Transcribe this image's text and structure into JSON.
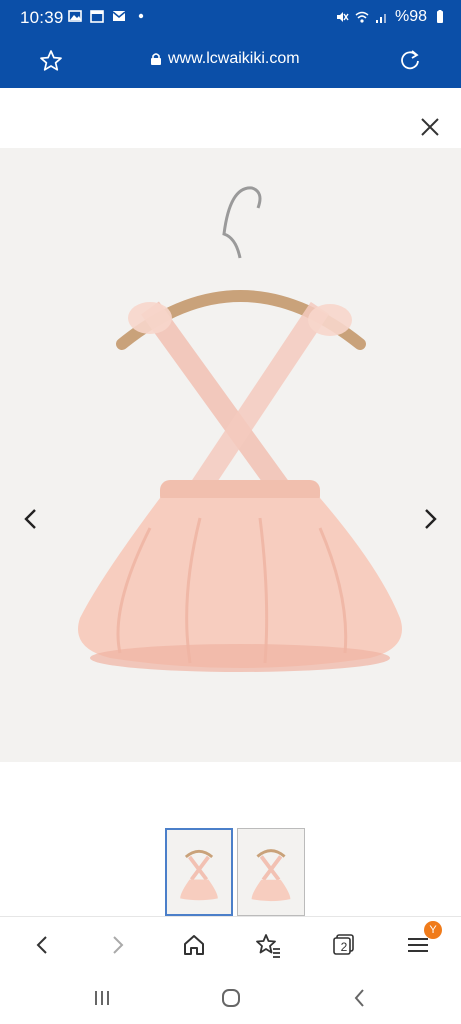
{
  "status_bar": {
    "time": "10:39",
    "battery": "%98",
    "left_icons": [
      "image-icon",
      "calendar-icon",
      "mail-icon",
      "dot-icon"
    ],
    "right_icons": [
      "mute-icon",
      "wifi-icon",
      "signal-icon",
      "battery-icon"
    ]
  },
  "address_bar": {
    "url": "www.lcwaikiki.com",
    "icons": [
      "star-icon",
      "lock-icon",
      "reload-icon"
    ]
  },
  "gallery": {
    "image_description_icon": "product-photo",
    "current_index": 1,
    "total": 2
  },
  "toolbar": {
    "badge": "Y",
    "buttons": [
      "back",
      "forward",
      "home",
      "bookmarks",
      "tabs",
      "menu"
    ],
    "tabs_count": "2"
  },
  "colors": {
    "brand_blue": "#0b4fa8",
    "badge_orange": "#f07b1a",
    "active_thumb": "#4b7fc9"
  }
}
